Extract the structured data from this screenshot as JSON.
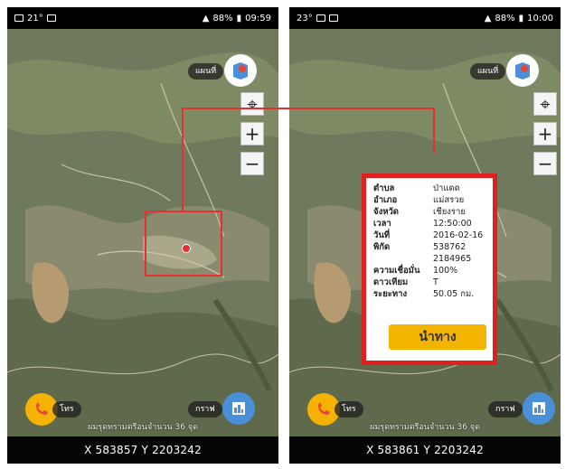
{
  "left": {
    "status": {
      "icons_left": "21°",
      "signal": "88%",
      "time": "09:59"
    },
    "map_label": "แผนที่",
    "call_label": "โทร",
    "graph_label": "กราฟ",
    "watermark": "ผมรุดทรามตรีอนจำนวน 36 จุด",
    "coords": "X 583857 Y 2203242"
  },
  "right": {
    "status": {
      "icons_left": "23°",
      "signal": "88%",
      "time": "10:00"
    },
    "map_label": "แผนที่",
    "call_label": "โทร",
    "graph_label": "กราฟ",
    "watermark": "ผมรุดทรามตรีอนจำนวน 36 จุด",
    "coords": "X 583861 Y 2203242",
    "info": {
      "rows": [
        {
          "k": "ตำบล",
          "v": "ป่าแดด"
        },
        {
          "k": "อำเภอ",
          "v": "แม่สรวย"
        },
        {
          "k": "จังหวัด",
          "v": "เชียงราย"
        },
        {
          "k": "เวลา",
          "v": "12:50:00"
        },
        {
          "k": "วันที่",
          "v": "2016-02-16"
        },
        {
          "k": "พิกัด",
          "v": "538762"
        },
        {
          "k": "",
          "v": "2184965"
        },
        {
          "k": "ความเชื่อมั่น",
          "v": "100%"
        },
        {
          "k": "ดาวเทียม",
          "v": "T"
        },
        {
          "k": "ระยะทาง",
          "v": "50.05 กม."
        }
      ],
      "nav_button": "นำทาง"
    }
  },
  "colors": {
    "accent_red": "#e53030",
    "nav_button": "#f4b400",
    "statusbar": "#000000"
  },
  "icons": [
    "map-layer-icon",
    "locate-crosshair-icon",
    "zoom-plus-icon",
    "zoom-minus-icon",
    "phone-call-icon",
    "graph-icon"
  ]
}
